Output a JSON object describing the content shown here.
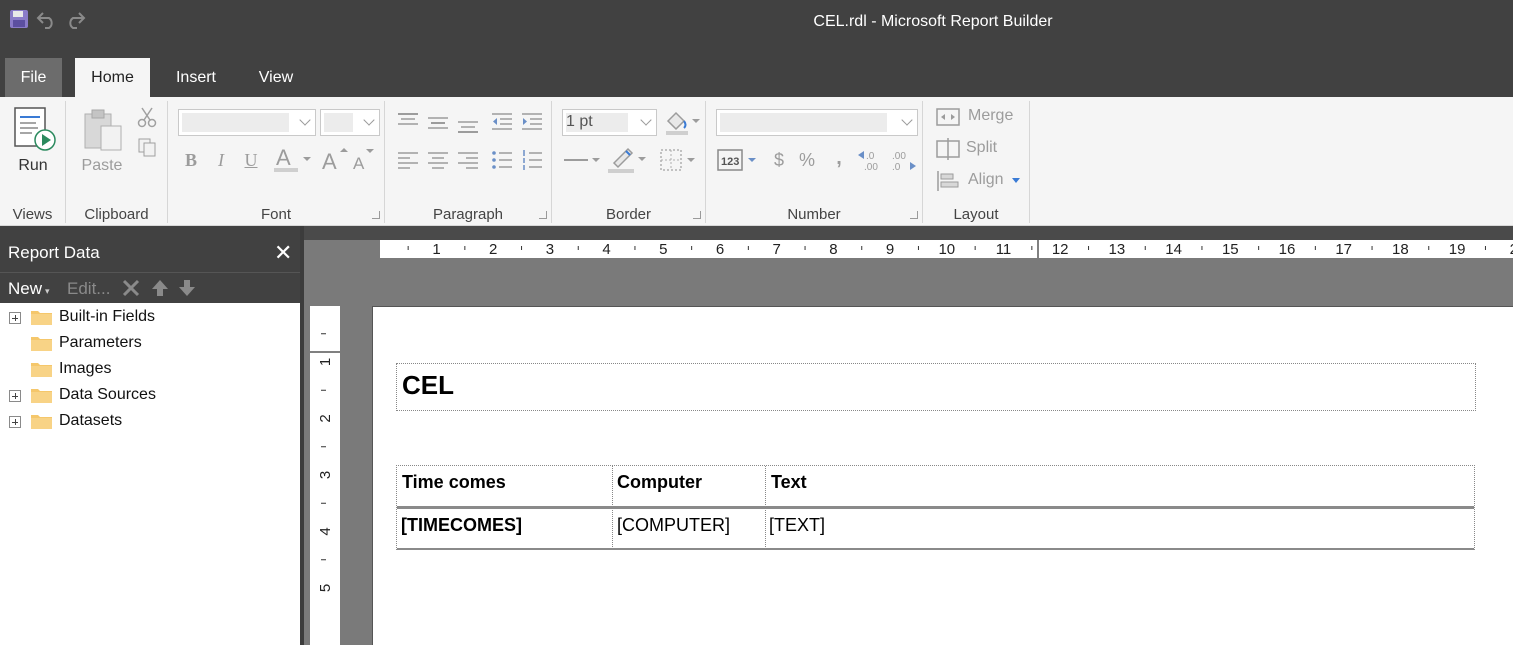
{
  "window": {
    "title": "CEL.rdl - Microsoft Report Builder"
  },
  "quick_access": [
    "save-icon",
    "undo-icon",
    "redo-icon"
  ],
  "tabs": [
    {
      "label": "File"
    },
    {
      "label": "Home"
    },
    {
      "label": "Insert"
    },
    {
      "label": "View"
    }
  ],
  "ribbon": {
    "views": {
      "label": "Views",
      "run_label": "Run"
    },
    "clipboard": {
      "label": "Clipboard",
      "paste_label": "Paste"
    },
    "font": {
      "label": "Font"
    },
    "paragraph": {
      "label": "Paragraph"
    },
    "border": {
      "label": "Border",
      "width_value": "1 pt"
    },
    "number": {
      "label": "Number"
    },
    "layout": {
      "label": "Layout",
      "merge_label": "Merge",
      "split_label": "Split",
      "align_label": "Align"
    }
  },
  "report_data": {
    "title": "Report Data",
    "new_label": "New",
    "edit_label": "Edit...",
    "items": [
      {
        "label": "Built-in Fields",
        "expandable": true
      },
      {
        "label": "Parameters",
        "expandable": false
      },
      {
        "label": "Images",
        "expandable": false
      },
      {
        "label": "Data Sources",
        "expandable": true
      },
      {
        "label": "Datasets",
        "expandable": true
      }
    ]
  },
  "rulers": {
    "horizontal": [
      "1",
      "2",
      "3",
      "4",
      "5",
      "6",
      "7",
      "8",
      "9",
      "10",
      "11",
      "12",
      "13",
      "14",
      "15",
      "16",
      "17",
      "18",
      "19",
      "2"
    ],
    "vertical": [
      "1",
      "2",
      "3",
      "4",
      "5"
    ]
  },
  "report": {
    "title": "CEL",
    "columns": [
      "Time comes",
      "Computer",
      "Text"
    ],
    "row": [
      "[TIMECOMES]",
      "[COMPUTER]",
      "[TEXT]"
    ]
  },
  "colors": {
    "chrome": "#414141",
    "ribbon": "#f5f5f5",
    "canvas": "#7a7a7a"
  }
}
